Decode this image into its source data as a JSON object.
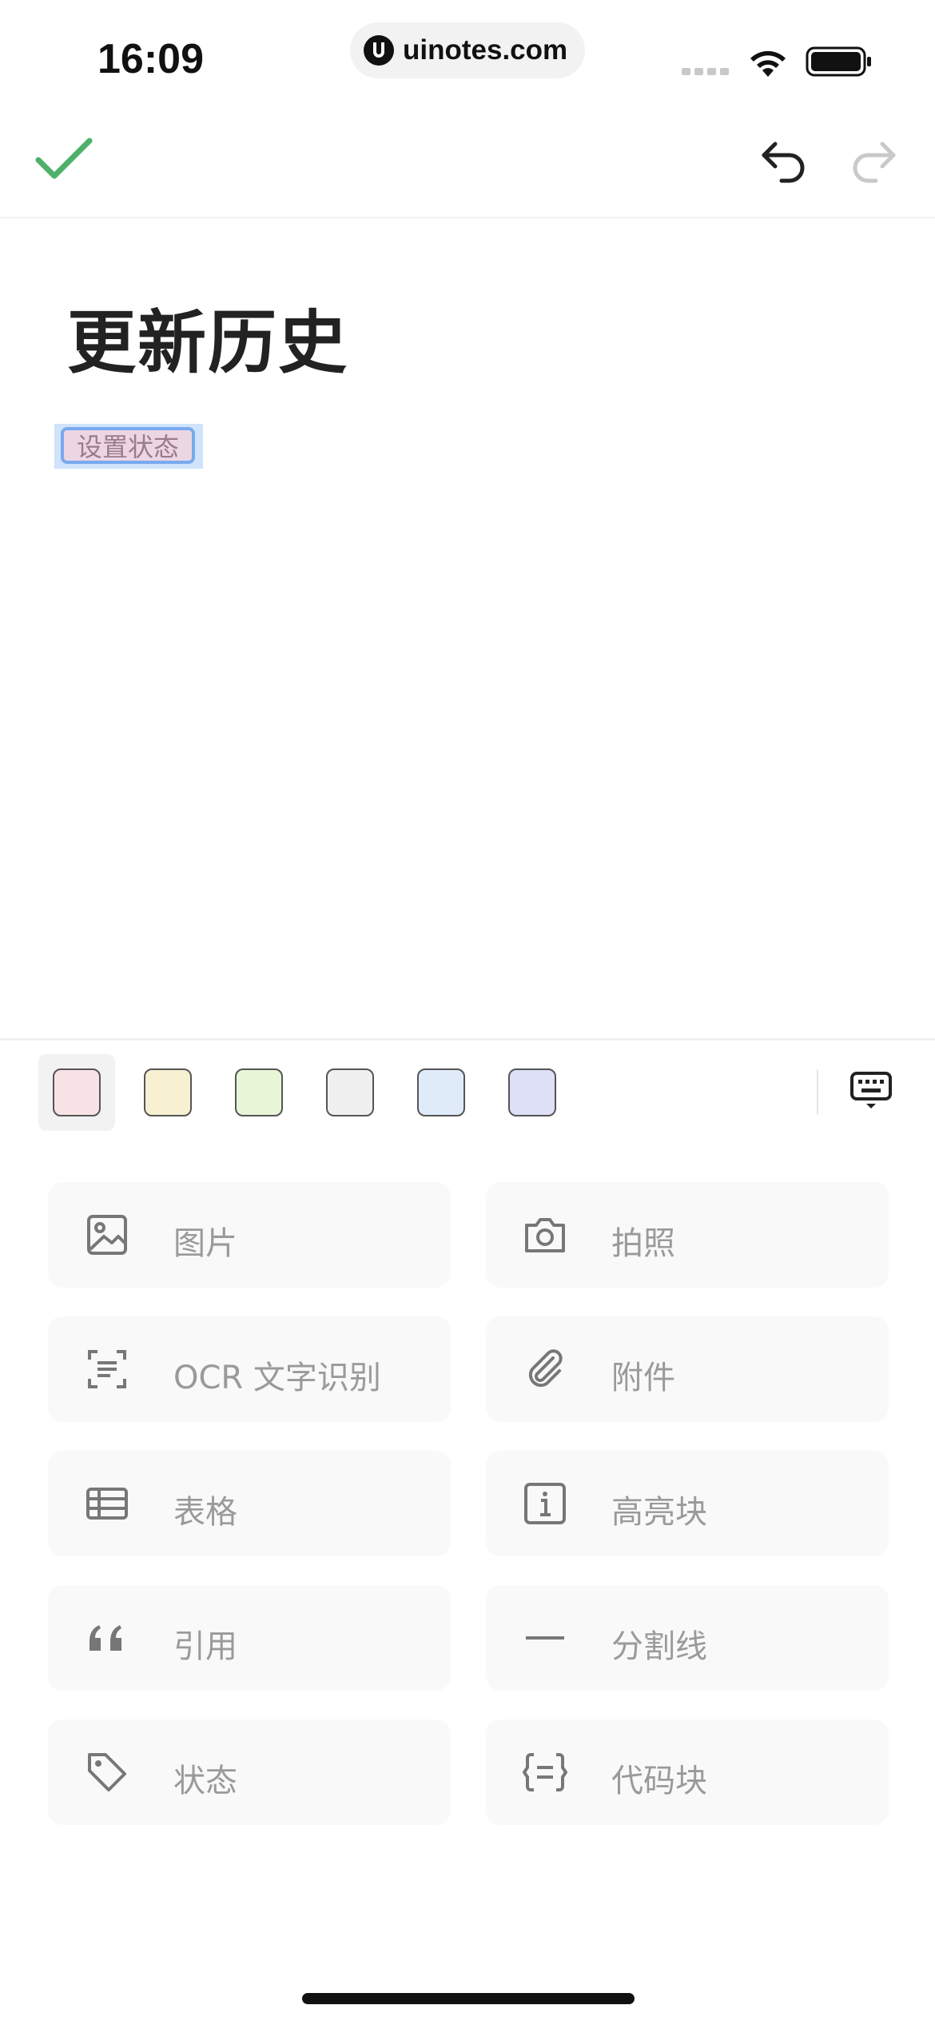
{
  "status_bar": {
    "time": "16:09",
    "url": "uinotes.com"
  },
  "toolbar": {
    "done_icon": "check-icon",
    "undo_icon": "undo-icon",
    "redo_icon": "redo-icon"
  },
  "note": {
    "title": "更新历史",
    "status_tag": "设置状态"
  },
  "colors": {
    "accent_check": "#4fb06a",
    "swatches": [
      "#f7e3e6",
      "#f7f0d1",
      "#e8f6d8",
      "#f0f0f0",
      "#e0ebfa",
      "#dde0f7"
    ]
  },
  "actions": [
    {
      "label": "图片",
      "icon": "image-icon"
    },
    {
      "label": "拍照",
      "icon": "camera-icon"
    },
    {
      "label": "OCR 文字识别",
      "icon": "ocr-scan-icon"
    },
    {
      "label": "附件",
      "icon": "paperclip-icon"
    },
    {
      "label": "表格",
      "icon": "table-icon"
    },
    {
      "label": "高亮块",
      "icon": "info-icon"
    },
    {
      "label": "引用",
      "icon": "quote-icon"
    },
    {
      "label": "分割线",
      "icon": "divider-line-icon"
    },
    {
      "label": "状态",
      "icon": "tag-icon"
    },
    {
      "label": "代码块",
      "icon": "code-block-icon"
    }
  ]
}
